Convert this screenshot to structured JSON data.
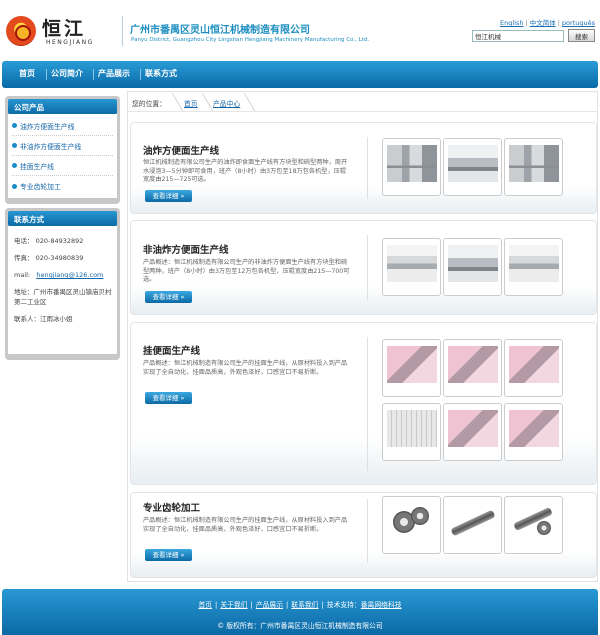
{
  "header": {
    "logo_cn": "恒江",
    "logo_en": "HENGJIANG",
    "company_cn": "广州市番禺区灵山恒江机械制造有限公司",
    "company_en": "Panyu District, Guangzhou City Lingshan Hengjiang Machinery Manufacturing Co., Ltd.",
    "languages": [
      "English",
      "中文简体",
      "português"
    ],
    "search_value": "恒江机械",
    "search_button": "搜索"
  },
  "nav": {
    "items": [
      "首页",
      "公司简介",
      "产品展示",
      "联系方式"
    ]
  },
  "sidebar": {
    "products_title": "公司产品",
    "products": [
      "油炸方便面生产线",
      "非油炸方便面生产线",
      "挂面生产线",
      "专业齿轮加工"
    ],
    "contact_title": "联系方式",
    "contact": {
      "phone_label": "电话：",
      "phone": "020-84932892",
      "fax_label": "传真：",
      "fax": "020-34980839",
      "mail_label": "mail:",
      "mail": "hengjiang@126.com",
      "address": "地址：广州市番禺区灵山镇庙贝村第二工业区",
      "person": "联系人：江雨冰小姐"
    }
  },
  "breadcrumb": {
    "label": "您的位置：",
    "items": [
      "首页",
      "产品中心"
    ]
  },
  "products": [
    {
      "title": "油炸方便面生产线",
      "desc": "恒江机械制造有限公司生产的油炸即食面生产线有方块型和碗型两种，周开水浸泡3—5分钟即可食用，班产（8小时）由3万包至18万包各机型，压辊宽度由215—725可选。",
      "button": "查看详细 »"
    },
    {
      "title": "非油炸方便面生产线",
      "desc": "产品概述：恒江机械制造有限公司生产的非油炸方便面生产线有方块型和碗型两种，班产（8小时）由3万包至12万包各机型，压辊宽度由215—700可选。",
      "button": "查看详细 »"
    },
    {
      "title": "挂便面生产线",
      "desc": "产品概述：恒江机械制造有限公司生产的挂面生产线，从原材料投入到产品实现了全自动化，挂面品质高，外观色泽好，口感宜口不易折断。",
      "button": "查看详细 »"
    },
    {
      "title": "专业齿轮加工",
      "desc": "产品概述：恒江机械制造有限公司生产的挂面生产线，从原材料投入到产品实现了全自动化，挂面品质高，外观色泽好，口感宜口不易折断。",
      "button": "查看详细 »"
    }
  ],
  "footer": {
    "links": [
      "首页",
      "关于我们",
      "产品展示",
      "联系我们"
    ],
    "support_label": "技术支持：",
    "support_link": "番禺网络科技",
    "copyright": "©  版权所有：广州市番禺区灵山恒江机械制造有限公司"
  }
}
